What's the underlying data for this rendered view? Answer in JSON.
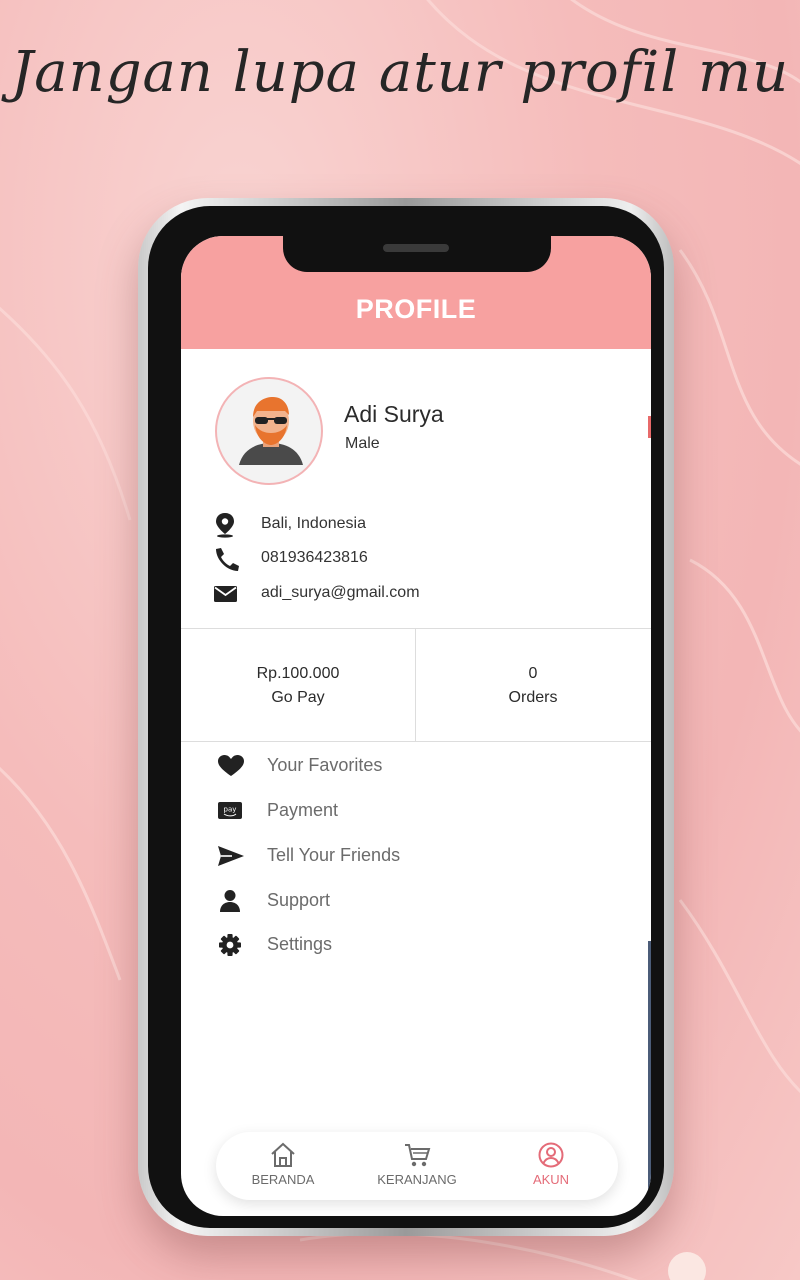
{
  "headline": "Jangan lupa atur profil mu",
  "header": {
    "title": "PROFILE"
  },
  "profile": {
    "name": "Adi Surya",
    "gender": "Male",
    "location": "Bali, Indonesia",
    "phone": "081936423816",
    "email": "adi_surya@gmail.com"
  },
  "stats": {
    "gopay_value": "Rp.100.000",
    "gopay_label": "Go Pay",
    "orders_value": "0",
    "orders_label": "Orders"
  },
  "menu": [
    {
      "label": "Your Favorites",
      "icon": "heart-icon"
    },
    {
      "label": "Payment",
      "icon": "pay-icon"
    },
    {
      "label": "Tell Your Friends",
      "icon": "send-icon"
    },
    {
      "label": "Support",
      "icon": "user-icon"
    },
    {
      "label": "Settings",
      "icon": "gear-icon"
    }
  ],
  "bottom_nav": [
    {
      "label": "BERANDA",
      "icon": "home-icon",
      "active": false
    },
    {
      "label": "KERANJANG",
      "icon": "cart-icon",
      "active": false
    },
    {
      "label": "AKUN",
      "icon": "account-icon",
      "active": true
    }
  ],
  "colors": {
    "accent": "#f7a1a0",
    "active_nav": "#e46b78",
    "background": "#f5bcbb"
  }
}
